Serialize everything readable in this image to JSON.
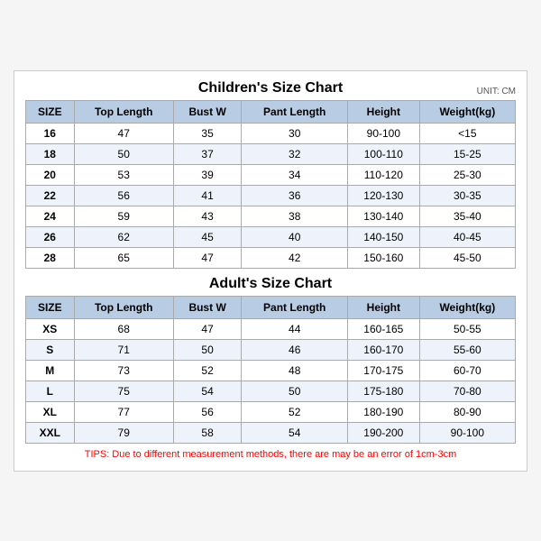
{
  "children_title": "Children's Size Chart",
  "adult_title": "Adult's Size Chart",
  "unit": "UNIT: CM",
  "children_headers": [
    "SIZE",
    "Top Length",
    "Bust W",
    "Pant Length",
    "Height",
    "Weight(kg)"
  ],
  "children_rows": [
    [
      "16",
      "47",
      "35",
      "30",
      "90-100",
      "<15"
    ],
    [
      "18",
      "50",
      "37",
      "32",
      "100-110",
      "15-25"
    ],
    [
      "20",
      "53",
      "39",
      "34",
      "110-120",
      "25-30"
    ],
    [
      "22",
      "56",
      "41",
      "36",
      "120-130",
      "30-35"
    ],
    [
      "24",
      "59",
      "43",
      "38",
      "130-140",
      "35-40"
    ],
    [
      "26",
      "62",
      "45",
      "40",
      "140-150",
      "40-45"
    ],
    [
      "28",
      "65",
      "47",
      "42",
      "150-160",
      "45-50"
    ]
  ],
  "adult_headers": [
    "SIZE",
    "Top Length",
    "Bust W",
    "Pant Length",
    "Height",
    "Weight(kg)"
  ],
  "adult_rows": [
    [
      "XS",
      "68",
      "47",
      "44",
      "160-165",
      "50-55"
    ],
    [
      "S",
      "71",
      "50",
      "46",
      "160-170",
      "55-60"
    ],
    [
      "M",
      "73",
      "52",
      "48",
      "170-175",
      "60-70"
    ],
    [
      "L",
      "75",
      "54",
      "50",
      "175-180",
      "70-80"
    ],
    [
      "XL",
      "77",
      "56",
      "52",
      "180-190",
      "80-90"
    ],
    [
      "XXL",
      "79",
      "58",
      "54",
      "190-200",
      "90-100"
    ]
  ],
  "tips": "TIPS: Due to different measurement methods, there are may be an error of 1cm-3cm"
}
